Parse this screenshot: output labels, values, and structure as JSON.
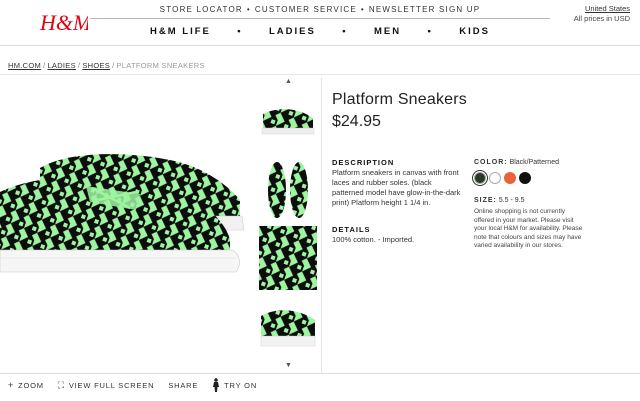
{
  "brand": {
    "logo_text": "H&M"
  },
  "utility_nav": [
    {
      "label": "STORE LOCATOR"
    },
    {
      "label": "CUSTOMER SERVICE"
    },
    {
      "label": "NEWSLETTER SIGN UP"
    }
  ],
  "country": {
    "name": "United States",
    "currency_note": "All prices in USD"
  },
  "main_nav": [
    {
      "label": "H&M LIFE"
    },
    {
      "label": "LADIES"
    },
    {
      "label": "MEN"
    },
    {
      "label": "KIDS"
    }
  ],
  "breadcrumb": {
    "items": [
      "HM.COM",
      "LADIES",
      "SHOES"
    ],
    "current": "PLATFORM SNEAKERS"
  },
  "product": {
    "title": "Platform Sneakers",
    "price": "$24.95",
    "description_heading": "DESCRIPTION",
    "description": "Platform sneakers in canvas with front laces and rubber soles. (black patterned model have glow-in-the-dark print) Platform height 1 1/4 in.",
    "details_heading": "DETAILS",
    "details": "100% cotton. - Imported.",
    "color_heading": "COLOR:",
    "color_value": "Black/Patterned",
    "swatches": [
      "#2a3a2a",
      "#ffffff",
      "#e8623a",
      "#111111"
    ],
    "size_heading": "SIZE:",
    "size_value": "5.5 - 9.5",
    "availability_note": "Online shopping is not currently offered in your market. Please visit your local H&M for availability. Please note that colours and sizes may have varied availability in our stores."
  },
  "thumbnails": {
    "up_arrow": "▲",
    "down_arrow": "▼"
  },
  "toolbar": {
    "zoom": "ZOOM",
    "full_screen": "VIEW FULL SCREEN",
    "share": "SHARE",
    "try_on": "TRY ON"
  },
  "colors": {
    "accent_red": "#e50010",
    "print_green": "#9ef5a0"
  }
}
